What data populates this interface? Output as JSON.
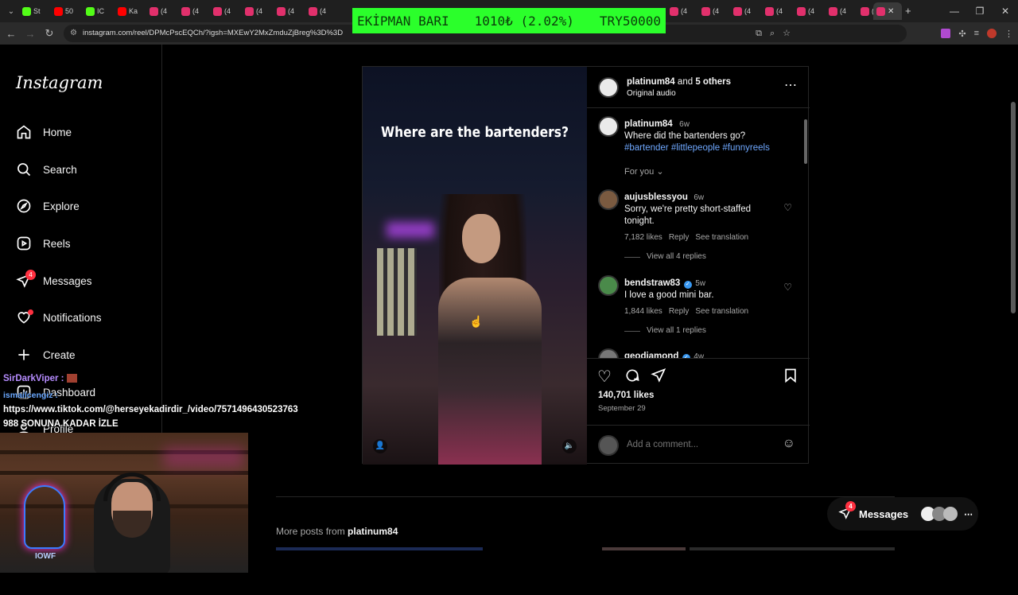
{
  "browser": {
    "tabs": [
      {
        "icon": "k-icon",
        "label": "St",
        "color": "#53fc18"
      },
      {
        "icon": "youtube-icon",
        "label": "50",
        "color": "#ff0000"
      },
      {
        "icon": "k-icon",
        "label": "IC",
        "color": "#53fc18"
      },
      {
        "icon": "youtube-icon",
        "label": "Ka",
        "color": "#ff0000"
      },
      {
        "icon": "instagram-icon",
        "label": "(4",
        "color": "#e1306c"
      },
      {
        "icon": "instagram-icon",
        "label": "(4",
        "color": "#e1306c"
      },
      {
        "icon": "instagram-icon",
        "label": "(4",
        "color": "#e1306c"
      },
      {
        "icon": "instagram-icon",
        "label": "(4",
        "color": "#e1306c"
      },
      {
        "icon": "instagram-icon",
        "label": "(4",
        "color": "#e1306c"
      },
      {
        "icon": "instagram-icon",
        "label": "(4",
        "color": "#e1306c"
      }
    ],
    "tabs_right": [
      {
        "icon": "instagram-icon",
        "label": "(4",
        "color": "#e1306c"
      },
      {
        "icon": "instagram-icon",
        "label": "(4",
        "color": "#e1306c"
      },
      {
        "icon": "instagram-icon",
        "label": "(4",
        "color": "#e1306c"
      },
      {
        "icon": "instagram-icon",
        "label": "(4",
        "color": "#e1306c"
      },
      {
        "icon": "instagram-icon",
        "label": "(4",
        "color": "#e1306c"
      },
      {
        "icon": "instagram-icon",
        "label": "(4",
        "color": "#e1306c"
      },
      {
        "icon": "instagram-icon",
        "label": "(4",
        "color": "#e1306c"
      }
    ],
    "url": "instagram.com/reel/DPMcPscEQCh/?igsh=MXEwY2MxZmduZjBreg%3D%3D"
  },
  "ticker": {
    "left": "EKİPMAN BARI",
    "middle": "1010₺ (2.02%)",
    "right": "TRY50000",
    "color": "#2bff2b"
  },
  "sidebar": {
    "logo": "Instagram",
    "items": [
      {
        "label": "Home",
        "icon": "home-icon"
      },
      {
        "label": "Search",
        "icon": "search-icon"
      },
      {
        "label": "Explore",
        "icon": "compass-icon"
      },
      {
        "label": "Reels",
        "icon": "reels-icon"
      },
      {
        "label": "Messages",
        "icon": "messenger-icon",
        "badge": "4"
      },
      {
        "label": "Notifications",
        "icon": "heart-icon"
      },
      {
        "label": "Create",
        "icon": "plus-icon"
      },
      {
        "label": "Dashboard",
        "icon": "dashboard-icon"
      },
      {
        "label": "Profile",
        "icon": "profile-icon"
      }
    ]
  },
  "post": {
    "video_caption": "Where are the bartenders?",
    "header": {
      "user": "platinum84",
      "and": "and",
      "others": "5 others",
      "audio": "Original audio"
    },
    "caption": {
      "user": "platinum84",
      "age": "6w",
      "text": "Where did the bartenders go?",
      "tags": "#bartender #littlepeople #funnyreels"
    },
    "for_you": "For you",
    "comments": [
      {
        "user": "aujusblessyou",
        "age": "6w",
        "verified": false,
        "text": "Sorry, we're pretty short-staffed tonight.",
        "likes": "7,182 likes",
        "reply": "Reply",
        "translate": "See translation",
        "view_replies": "View all 4 replies"
      },
      {
        "user": "bendstraw83",
        "age": "5w",
        "verified": true,
        "text": "I love a good mini bar.",
        "likes": "1,844 likes",
        "reply": "Reply",
        "translate": "See translation",
        "view_replies": "View all 1 replies"
      },
      {
        "user": "geodiamond",
        "age": "4w",
        "verified": true
      }
    ],
    "likes": "140,701 likes",
    "date": "September 29",
    "comment_placeholder": "Add a comment..."
  },
  "more_posts": {
    "prefix": "More posts from",
    "user": "platinum84"
  },
  "messages_pill": {
    "label": "Messages",
    "badge": "4"
  },
  "overlay": {
    "chat_user": "SirDarkViper :",
    "chat_user2": "ismailcengiz :",
    "chat_link": "https://www.tiktok.com/@herseyekadirdir_/video/7571496430523763",
    "chat_msg": "988 SONUNA KADAR İZLE",
    "cam_logo": "IOWF"
  }
}
